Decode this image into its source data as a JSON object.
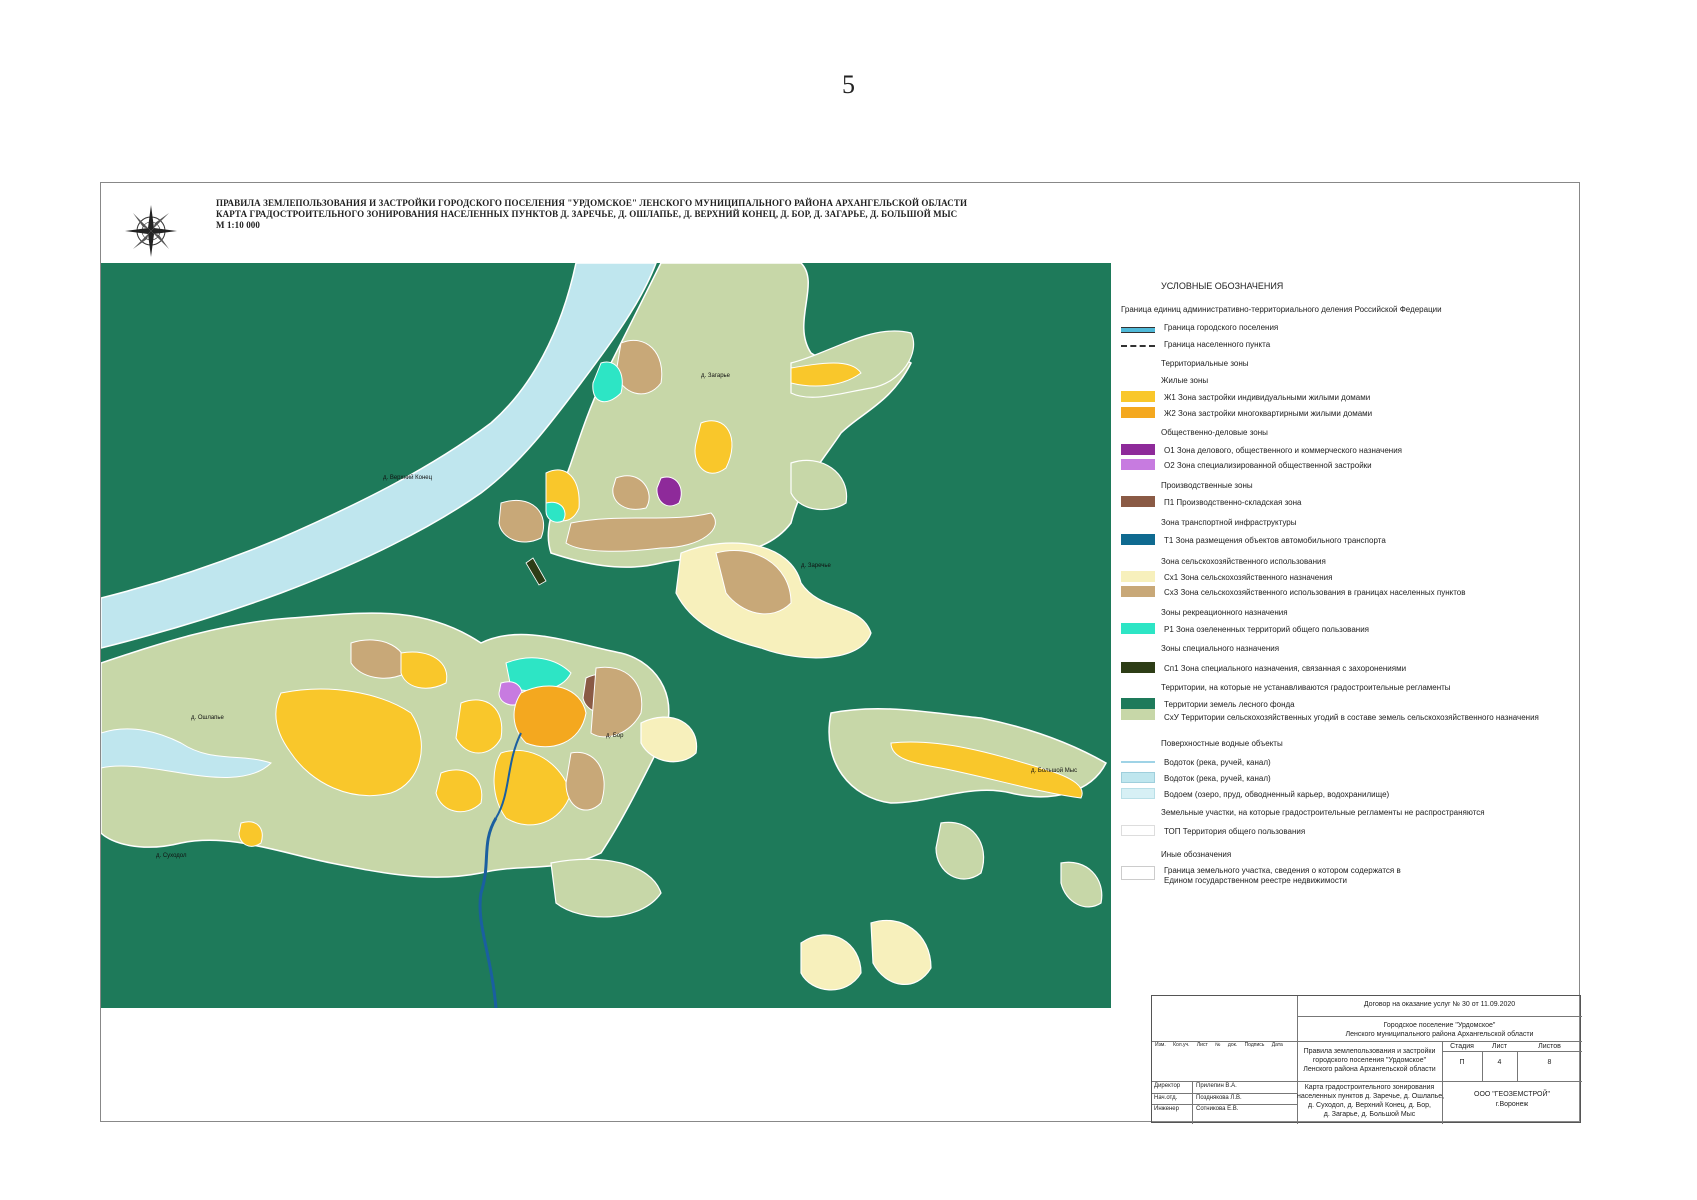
{
  "page_number": "5",
  "title": {
    "line1": "ПРАВИЛА ЗЕМЛЕПОЛЬЗОВАНИЯ И ЗАСТРОЙКИ ГОРОДСКОГО ПОСЕЛЕНИЯ \"УРДОМСКОЕ\" ЛЕНСКОГО МУНИЦИПАЛЬНОГО РАЙОНА АРХАНГЕЛЬСКОЙ ОБЛАСТИ",
    "line2": "КАРТА ГРАДОСТРОИТЕЛЬНОГО ЗОНИРОВАНИЯ НАСЕЛЕННЫХ ПУНКТОВ Д. ЗАРЕЧЬЕ, Д. ОШЛАПЬЕ, Д. ВЕРХНИЙ КОНЕЦ, Д. БОР, Д. ЗАГАРЬЕ, Д. БОЛЬШОЙ МЫС",
    "scale": "М 1:10 000"
  },
  "compass_icon": "compass-rose-icon",
  "map": {
    "colors": {
      "forest": "#1e7a5a",
      "river": "#bfe6ee",
      "agri": "#f7f0bc",
      "agri_settle": "#c8a878",
      "zh1": "#f9c72b",
      "zh2": "#f4a81f",
      "o1": "#8e2a9a",
      "o2": "#c77be0",
      "p1": "#8a5a45",
      "r1": "#2de5c5",
      "sp1": "#2d3d16",
      "sxu": "#c7d7a8",
      "stream": "#1a5fa0"
    },
    "labels": [
      {
        "id": "verkhny-konets",
        "text": "д. Верхний Конец"
      },
      {
        "id": "zagarye",
        "text": "д. Загарье"
      },
      {
        "id": "oshlapye",
        "text": "д. Ошлапье"
      },
      {
        "id": "bor",
        "text": "д. Бор"
      },
      {
        "id": "zarechye",
        "text": "д. Заречье"
      },
      {
        "id": "bolshoy-mys",
        "text": "д. Большой Мыс"
      },
      {
        "id": "sukhodol",
        "text": "д. Суходол"
      }
    ],
    "zone_codes": [
      "Ж1",
      "Ж2",
      "Сх3",
      "СхУ",
      "Сх1",
      "О1",
      "П1",
      "Р1"
    ]
  },
  "legend": {
    "heading": "УСЛОВНЫЕ ОБОЗНАЧЕНИЯ",
    "items": [
      {
        "kind": "text",
        "text": "Граница единиц административно-территориального деления Российской Федерации"
      },
      {
        "kind": "line",
        "text": "Граница городского поселения",
        "color": "#4fb9d8"
      },
      {
        "kind": "line",
        "text": "Граница населенного пункта",
        "color": "#333333"
      },
      {
        "kind": "text",
        "text": "Территориальные зоны"
      },
      {
        "kind": "text",
        "text": "Жилые зоны"
      },
      {
        "kind": "swatch",
        "text": "Ж1 Зона застройки индивидуальными жилыми домами",
        "color": "#f9c72b"
      },
      {
        "kind": "swatch",
        "text": "Ж2 Зона застройки многоквартирными жилыми домами",
        "color": "#f4a81f"
      },
      {
        "kind": "text",
        "text": "Общественно-деловые зоны"
      },
      {
        "kind": "swatch",
        "text": "О1 Зона делового, общественного и коммерческого назначения",
        "color": "#8e2a9a"
      },
      {
        "kind": "swatch",
        "text": "О2 Зона специализированной общественной застройки",
        "color": "#c77be0"
      },
      {
        "kind": "text",
        "text": "Производственные зоны"
      },
      {
        "kind": "swatch",
        "text": "П1 Производственно-складская зона",
        "color": "#8a5a45"
      },
      {
        "kind": "text",
        "text": "Зона транспортной инфраструктуры"
      },
      {
        "kind": "swatch",
        "text": "Т1 Зона размещения объектов автомобильного транспорта",
        "color": "#0f6a90"
      },
      {
        "kind": "text",
        "text": "Зона сельскохозяйственного использования"
      },
      {
        "kind": "swatch",
        "text": "Сх1 Зона сельскохозяйственного назначения",
        "color": "#f7f0bc"
      },
      {
        "kind": "swatch",
        "text": "Сх3 Зона сельскохозяйственного использования в границах населенных пунктов",
        "color": "#c8a878"
      },
      {
        "kind": "text",
        "text": "Зоны рекреационного назначения"
      },
      {
        "kind": "swatch",
        "text": "Р1 Зона озелененных территорий общего пользования",
        "color": "#2de5c5"
      },
      {
        "kind": "text",
        "text": "Зоны специального назначения"
      },
      {
        "kind": "swatch",
        "text": "Сп1 Зона специального назначения, связанная с захоронениями",
        "color": "#2d3d16"
      },
      {
        "kind": "text",
        "text": "Территории, на которые не устанавливаются градостроительные регламенты"
      },
      {
        "kind": "swatch",
        "text": "Территории земель лесного фонда",
        "color": "#1e7a5a"
      },
      {
        "kind": "swatch",
        "text": "СхУ Территории сельскохозяйственных угодий в составе земель сельскохозяйственного назначения",
        "color": "#c7d7a8"
      },
      {
        "kind": "text",
        "text": "Поверхностные водные объекты"
      },
      {
        "kind": "line",
        "text": "Водоток (река, ручей, канал)",
        "color": "#9fd3e6"
      },
      {
        "kind": "swatch",
        "text": "Водоток (река, ручей, канал)",
        "color": "#bfe6ee"
      },
      {
        "kind": "swatch",
        "text": "Водоем (озеро, пруд, обводненный карьер, водохранилище)",
        "color": "#d7f0f5"
      },
      {
        "kind": "text",
        "text": "Земельные участки, на которые градостроительные регламенты не распространяются"
      },
      {
        "kind": "swatch",
        "text": "ТОП Территория общего пользования",
        "color": "#ffffff"
      },
      {
        "kind": "text",
        "text": "Иные обозначения"
      },
      {
        "kind": "swatch",
        "text": "Граница земельного участка, сведения о котором содержатся в",
        "text2": "Едином государственном реестре недвижимости",
        "color": "#ffffff"
      }
    ]
  },
  "stamp": {
    "contract": "Договор на оказание услуг № 30 от 11.09.2020",
    "org_line1": "Городское поселение \"Урдомское\"",
    "org_line2": "Ленского муниципального района Архангельской области",
    "doc_line1": "Правила землепользования и застройки",
    "doc_line2": "городского поселения \"Урдомское\"",
    "doc_line3": "Ленского района Архангельской области",
    "map_line1": "Карта градостроительного зонирования",
    "map_line2": "населенных пунктов д. Заречье, д. Ошлапье,",
    "map_line3": "д. Суходол, д. Верхний Конец, д. Бор,",
    "map_line4": "д. Загарье, д. Большой Мыс",
    "col_headers": [
      "Изм.",
      "Кол.уч.",
      "Лист",
      "№ док.",
      "Подпись",
      "Дата"
    ],
    "stage_header": "Стадия",
    "sheet_header": "Лист",
    "sheets_header": "Листов",
    "stage": "П",
    "sheet": "4",
    "sheets": "8",
    "roles": [
      {
        "role": "Директор",
        "name": "Прилепин В.А."
      },
      {
        "role": "Нач.отд.",
        "name": "Позднякова Л.В."
      },
      {
        "role": "Инженер",
        "name": "Сотникова Е.В."
      }
    ],
    "company": "ООО \"ГЕОЗЕМСТРОЙ\"",
    "city": "г.Воронеж"
  }
}
